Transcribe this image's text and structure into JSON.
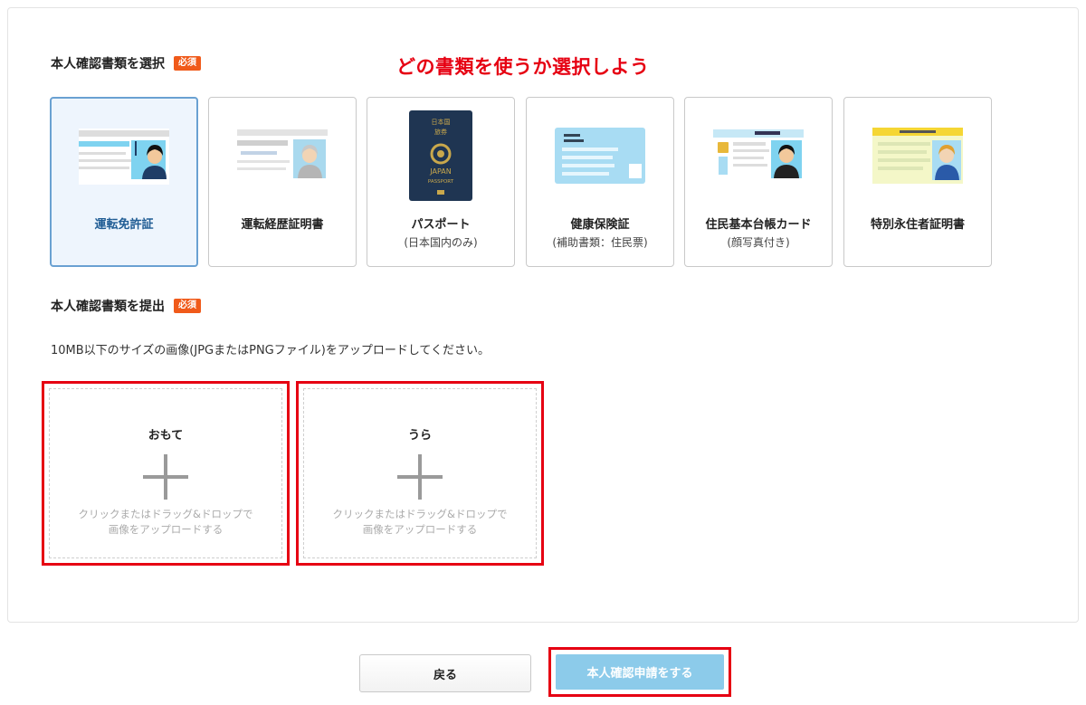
{
  "select_section": {
    "title": "本人確認書類を選択",
    "required_badge": "必須",
    "annotation": "どの書類を使うか選択しよう"
  },
  "documents": [
    {
      "name": "運転免許証",
      "sub": "",
      "selected": true,
      "icon": "drivers-license-icon"
    },
    {
      "name": "運転経歴証明書",
      "sub": "",
      "selected": false,
      "icon": "driving-history-certificate-icon"
    },
    {
      "name": "パスポート",
      "sub": "(日本国内のみ)",
      "selected": false,
      "icon": "passport-icon"
    },
    {
      "name": "健康保険証",
      "sub": "(補助書類：住民票)",
      "selected": false,
      "icon": "health-insurance-card-icon"
    },
    {
      "name": "住民基本台帳カード",
      "sub": "(顔写真付き)",
      "selected": false,
      "icon": "resident-register-card-icon"
    },
    {
      "name": "特別永住者証明書",
      "sub": "",
      "selected": false,
      "icon": "special-permanent-resident-certificate-icon"
    }
  ],
  "passport_text": {
    "top": "日本国",
    "mid": "旅券",
    "country": "JAPAN",
    "kind": "PASSPORT"
  },
  "submit_section": {
    "title": "本人確認書類を提出",
    "required_badge": "必須",
    "instructions": "10MB以下のサイズの画像(JPGまたはPNGファイル)をアップロードしてください。"
  },
  "uploads": {
    "front": {
      "label": "おもて",
      "hint_line1": "クリックまたはドラッグ&ドロップで",
      "hint_line2": "画像をアップロードする"
    },
    "back": {
      "label": "うら",
      "hint_line1": "クリックまたはドラッグ&ドロップで",
      "hint_line2": "画像をアップロードする"
    }
  },
  "buttons": {
    "back": "戻る",
    "submit": "本人確認申請をする"
  },
  "colors": {
    "annotation": "#e60012",
    "badge": "#f05a1a",
    "selected_border": "#6aa1d2",
    "submit": "#8ccbea",
    "highlight_frame": "#e60012"
  }
}
